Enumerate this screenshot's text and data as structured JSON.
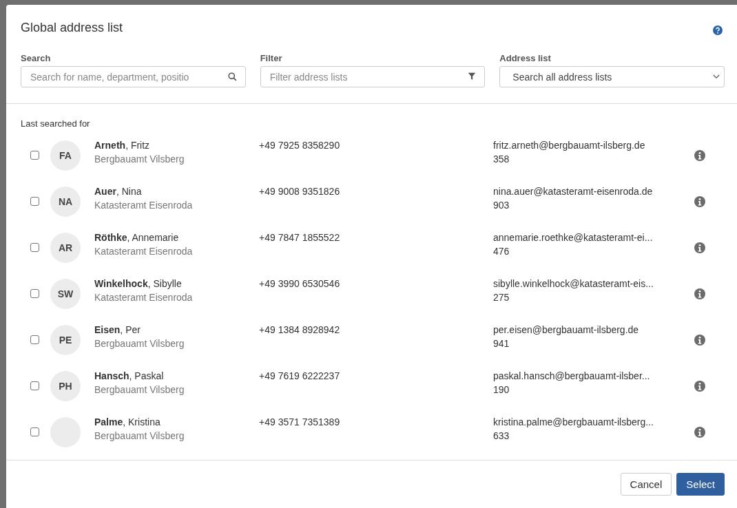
{
  "dialog": {
    "title": "Global address list"
  },
  "fields": [
    {
      "kind": "search",
      "label": "Search",
      "placeholder": "Search for name, department, positio"
    },
    {
      "kind": "filter",
      "label": "Filter",
      "placeholder": "Filter address lists"
    },
    {
      "kind": "select",
      "label": "Address list",
      "value": "Search all address lists"
    }
  ],
  "section_label": "Last searched for",
  "contacts": [
    {
      "checked": false,
      "initials": "FA",
      "name": "**Arneth**, Fritz",
      "department": "Bergbauamt Vilsberg",
      "phone": "+49 7925 8358290",
      "email": "fritz.arneth@bergbauamt-ilsberg.de",
      "extension": "358"
    },
    {
      "checked": false,
      "initials": "NA",
      "name": "**Auer**, Nina",
      "department": "Katasteramt Eisenroda",
      "phone": "+49 9008 9351826",
      "email": "nina.auer@katasteramt-eisenroda.de",
      "extension": "903"
    },
    {
      "checked": false,
      "initials": "AR",
      "name": "**Röthke**, Annemarie",
      "department": "Katasteramt Eisenroda",
      "phone": "+49 7847 1855522",
      "email": "annemarie.roethke@katasteramt-ei...",
      "extension": "476"
    },
    {
      "checked": false,
      "initials": "SW",
      "name": "**Winkelhock**, Sibylle",
      "department": "Katasteramt Eisenroda",
      "phone": "+49 3990 6530546",
      "email": "sibylle.winkelhock@katasteramt-eis...",
      "extension": "275"
    },
    {
      "checked": false,
      "initials": "PE",
      "name": "**Eisen**, Per",
      "department": "Bergbauamt Vilsberg",
      "phone": "+49 1384 8928942",
      "email": "per.eisen@bergbauamt-ilsberg.de",
      "extension": "941"
    },
    {
      "checked": false,
      "initials": "PH",
      "name": "**Hansch**, Paskal",
      "department": "Bergbauamt Vilsberg",
      "phone": "+49 7619 6222237",
      "email": "paskal.hansch@bergbauamt-ilsber...",
      "extension": "190"
    },
    {
      "checked": false,
      "name": "**Palme**, Kristina",
      "department": "Bergbauamt Vilsberg",
      "phone": "+49 3571 7351389",
      "email": "kristina.palme@bergbauamt-ilsberg...",
      "extension": "633"
    }
  ],
  "buttons": [
    {
      "kind": "secondary",
      "label": "Cancel"
    },
    {
      "kind": "primary",
      "label": "Select"
    }
  ]
}
